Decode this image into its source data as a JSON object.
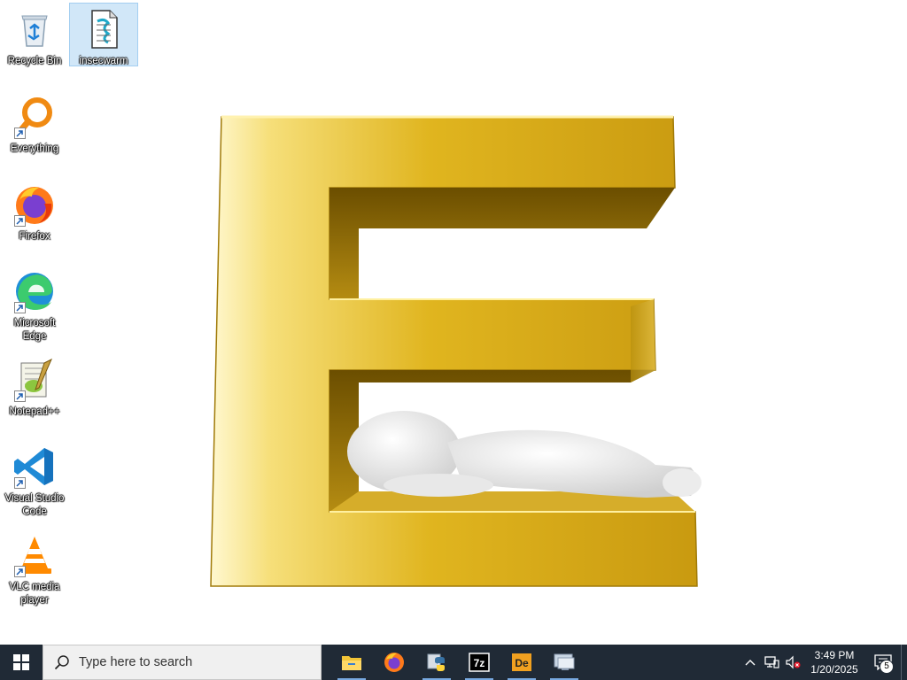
{
  "desktop": {
    "icons": [
      {
        "label": "Recycle Bin",
        "icon": "recycle-bin-icon"
      },
      {
        "label": "insecwarm",
        "icon": "document-icon",
        "selected": true
      },
      {
        "label": "Everything",
        "icon": "everything-search-icon"
      },
      {
        "label": "Firefox",
        "icon": "firefox-icon"
      },
      {
        "label": "Microsoft Edge",
        "icon": "edge-icon"
      },
      {
        "label": "Notepad++",
        "icon": "notepad-plus-plus-icon"
      },
      {
        "label": "Visual Studio Code",
        "icon": "vscode-icon"
      },
      {
        "label": "VLC media player",
        "icon": "vlc-icon"
      }
    ]
  },
  "taskbar": {
    "search_placeholder": "Type here to search",
    "apps": [
      {
        "name": "File Explorer",
        "icon": "file-explorer-icon"
      },
      {
        "name": "Firefox",
        "icon": "firefox-icon"
      },
      {
        "name": "Python",
        "icon": "python-icon"
      },
      {
        "name": "7-Zip",
        "icon": "7zip-icon"
      },
      {
        "name": "Dependencies",
        "icon": "dependencies-icon"
      },
      {
        "name": "Remote Desktop",
        "icon": "remote-desktop-icon"
      }
    ],
    "clock": {
      "time": "3:49 PM",
      "date": "1/20/2025"
    },
    "notification_count": "5"
  },
  "colors": {
    "taskbar_bg": "#202a36",
    "gold": "#e0b21a",
    "accent": "#78a9e0"
  }
}
